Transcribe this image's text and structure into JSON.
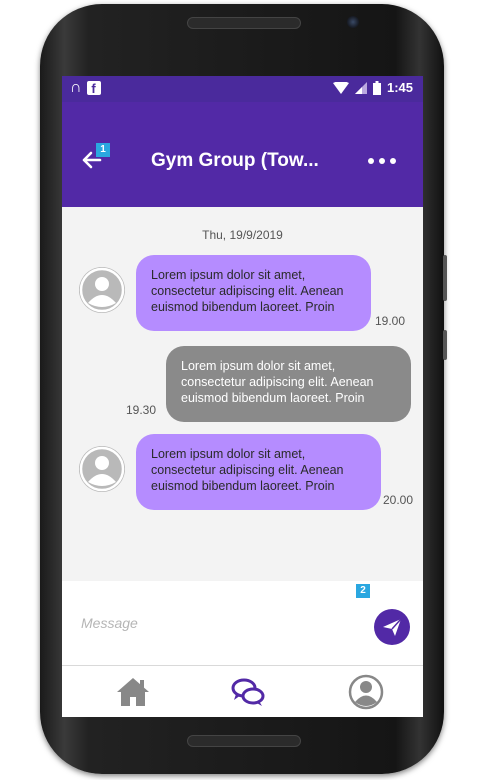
{
  "status_bar": {
    "time": "1:45",
    "left_icons": [
      "n-notification-icon",
      "facebook-icon"
    ],
    "right_icons": [
      "wifi-icon",
      "signal-icon",
      "battery-icon"
    ]
  },
  "header": {
    "title": "Gym Group (Tow...",
    "back_badge": "1",
    "background": "#5229a6"
  },
  "conversation": {
    "date": "Thu, 19/9/2019",
    "messages": [
      {
        "direction": "incoming",
        "text": "Lorem ipsum dolor sit amet, consectetur adipiscing elit. Aenean euismod bibendum laoreet. Proin",
        "time": "19.00"
      },
      {
        "direction": "outgoing",
        "text": "Lorem ipsum dolor sit amet, consectetur adipiscing elit. Aenean euismod bibendum laoreet. Proin",
        "time": "19.30"
      },
      {
        "direction": "incoming",
        "text": "Lorem ipsum dolor sit amet, consectetur adipiscing elit. Aenean euismod bibendum laoreet. Proin",
        "time": "20.00"
      }
    ]
  },
  "composer": {
    "placeholder": "Message",
    "value": "",
    "badge": "2"
  },
  "bottom_nav": {
    "items": [
      {
        "icon": "home-icon",
        "active": false
      },
      {
        "icon": "chat-icon",
        "active": true
      },
      {
        "icon": "profile-icon",
        "active": false
      }
    ]
  },
  "colors": {
    "accent": "#5229a6",
    "incoming_bubble": "#b58cff",
    "outgoing_bubble": "#8a8a8a",
    "badge": "#2aa7e0"
  }
}
